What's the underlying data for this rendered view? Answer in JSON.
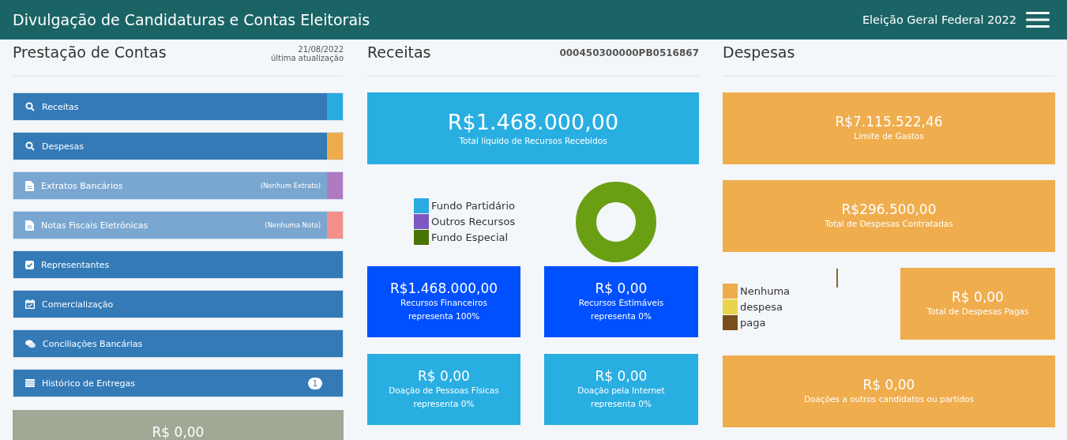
{
  "header": {
    "title": "Divulgação de Candidaturas e Contas Eleitorais",
    "election": "Eleição Geral Federal 2022"
  },
  "prestacao": {
    "title": "Prestação de Contas",
    "date": "21/08/2022",
    "date_label": "última atualização",
    "items": [
      {
        "label": "Receitas",
        "kind": "search",
        "disabled": false,
        "color": "#29aae1"
      },
      {
        "label": "Despesas",
        "kind": "search",
        "disabled": false,
        "color": "#eeac4d"
      },
      {
        "label": "Extratos Bancários",
        "kind": "document",
        "disabled": true,
        "note": "(Nenhum Extrato)",
        "color": "#ae7bc1"
      },
      {
        "label": "Notas Fiscais Eletrônicas",
        "kind": "document",
        "disabled": true,
        "note": "(Nenhuma Nota)",
        "color": "#f3908a"
      },
      {
        "label": "Representantes",
        "kind": "checklist",
        "disabled": false
      },
      {
        "label": "Comercialização",
        "kind": "schedule",
        "disabled": false
      },
      {
        "label": "Conciliações Bancárias",
        "kind": "conversation",
        "disabled": false
      },
      {
        "label": "Histórico de Entregas",
        "kind": "history",
        "disabled": false,
        "badge": "1"
      }
    ],
    "bottom_card": {
      "value": "R$ 0,00"
    }
  },
  "receitas": {
    "title": "Receitas",
    "code": "000450300000PB0516867",
    "total": {
      "value": "R$1.468.000,00",
      "label": "Total líquido de Recursos Recebidos"
    },
    "legend": [
      {
        "label": "Fundo Partidário",
        "color": "#29aae1"
      },
      {
        "label": "Outros Recursos",
        "color": "#7e57c2"
      },
      {
        "label": "Fundo Especial",
        "color": "#4a7307"
      }
    ],
    "cards": [
      {
        "kind": "primary",
        "value": "R$1.468.000,00",
        "label": "Recursos Financeiros",
        "share": "representa 100%"
      },
      {
        "kind": "primary",
        "value": "R$ 0,00",
        "label": "Recursos Estimáveis",
        "share": "representa 0%"
      },
      {
        "kind": "info",
        "value": "R$ 0,00",
        "label": "Doação de Pessoas Físicas",
        "share": "representa 0%"
      },
      {
        "kind": "info",
        "value": "R$ 0,00",
        "label": "Doação pela Internet",
        "share": "representa 0%"
      }
    ]
  },
  "despesas": {
    "title": "Despesas",
    "limit": {
      "value": "R$7.115.522,46",
      "label": "Limite de Gastos"
    },
    "contracted": {
      "value": "R$296.500,00",
      "label": "Total de Despesas Contratadas"
    },
    "legend": [
      {
        "label": "Nenhuma",
        "color": "#eeac4d"
      },
      {
        "label": "despesa",
        "color": "#e8d44d"
      },
      {
        "label": "paga",
        "color": "#7a4e1c"
      }
    ],
    "paid": {
      "value": "R$ 0,00",
      "label": "Total de Despesas Pagas"
    },
    "donations": {
      "value": "R$ 0,00",
      "label": "Doações a outros candidatos ou partidos"
    }
  }
}
